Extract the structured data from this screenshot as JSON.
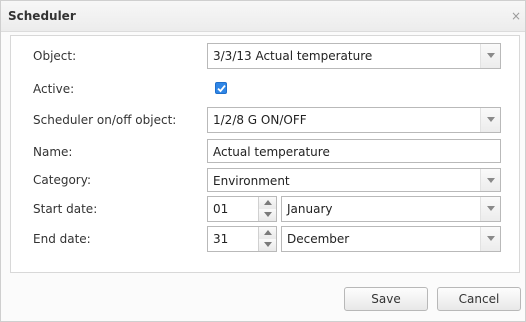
{
  "dialog": {
    "title": "Scheduler",
    "close_glyph": "×"
  },
  "form": {
    "object": {
      "label": "Object:",
      "value": "3/3/13 Actual temperature"
    },
    "active": {
      "label": "Active:",
      "checked": true
    },
    "onoff_object": {
      "label": "Scheduler on/off object:",
      "value": "1/2/8 G ON/OFF"
    },
    "name": {
      "label": "Name:",
      "value": "Actual temperature"
    },
    "category": {
      "label": "Category:",
      "value": "Environment"
    },
    "start_date": {
      "label": "Start date:",
      "day": "01",
      "month": "January"
    },
    "end_date": {
      "label": "End date:",
      "day": "31",
      "month": "December"
    }
  },
  "buttons": {
    "save": "Save",
    "cancel": "Cancel"
  },
  "colors": {
    "checkbox_accent": "#2f86e6"
  }
}
